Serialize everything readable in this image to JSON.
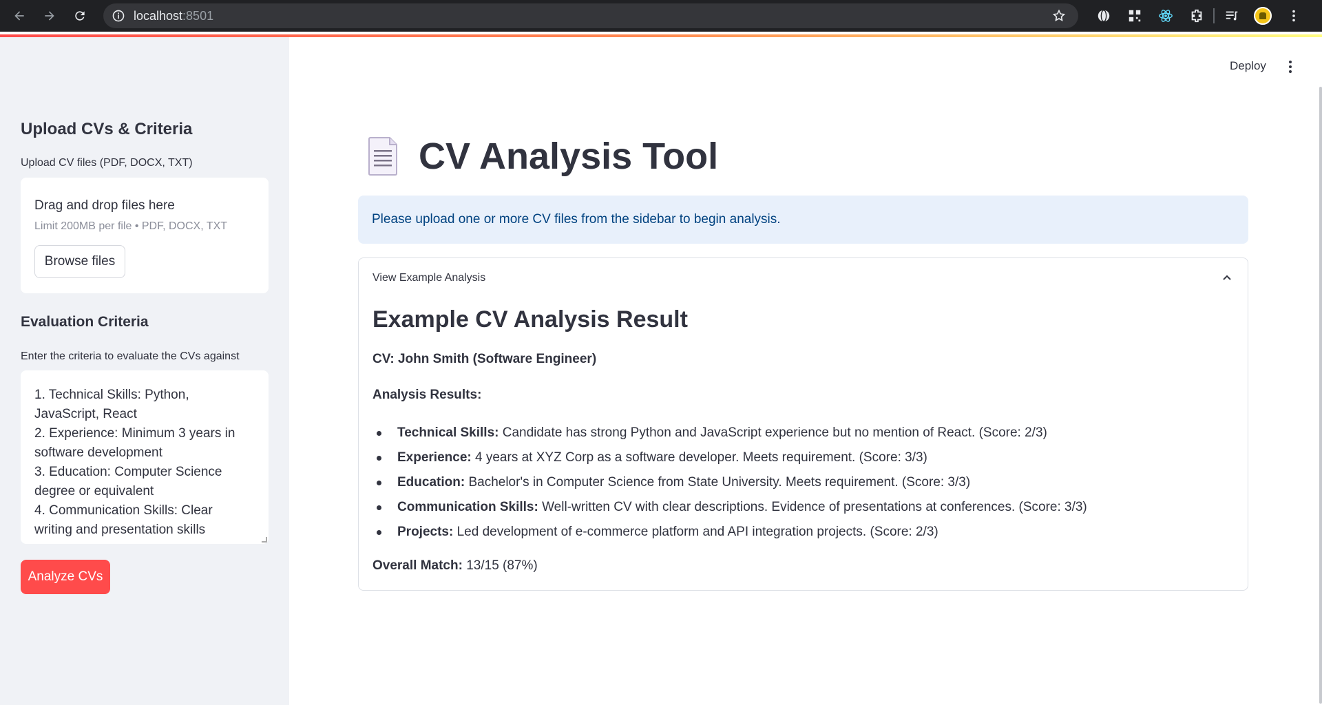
{
  "browser": {
    "url_host": "localhost",
    "url_port": ":8501"
  },
  "header": {
    "deploy_label": "Deploy"
  },
  "sidebar": {
    "upload_heading": "Upload CVs & Criteria",
    "upload_label": "Upload CV files (PDF, DOCX, TXT)",
    "dropzone_title": "Drag and drop files here",
    "dropzone_limit": "Limit 200MB per file • PDF, DOCX, TXT",
    "browse_label": "Browse files",
    "criteria_heading": "Evaluation Criteria",
    "criteria_label": "Enter the criteria to evaluate the CVs against",
    "criteria_lines": [
      "1. Technical Skills: Python,",
      "JavaScript, React",
      "2. Experience: Minimum 3 years in",
      "software development",
      "3. Education: Computer Science",
      "degree or equivalent",
      "4. Communication Skills: Clear",
      "writing and presentation skills"
    ],
    "analyze_label": "Analyze CVs"
  },
  "main": {
    "title": "CV Analysis Tool",
    "info_message": "Please upload one or more CV files from the sidebar to begin analysis.",
    "expander": {
      "label": "View Example Analysis",
      "result_title": "Example CV Analysis Result",
      "cv_line": "CV: John Smith (Software Engineer)",
      "results_label": "Analysis Results:",
      "items": [
        {
          "label": "Technical Skills:",
          "text": " Candidate has strong Python and JavaScript experience but no mention of React. (Score: 2/3)"
        },
        {
          "label": "Experience:",
          "text": " 4 years at XYZ Corp as a software developer. Meets requirement. (Score: 3/3)"
        },
        {
          "label": "Education:",
          "text": " Bachelor's in Computer Science from State University. Meets requirement. (Score: 3/3)"
        },
        {
          "label": "Communication Skills:",
          "text": " Well-written CV with clear descriptions. Evidence of presentations at conferences. (Score: 3/3)"
        },
        {
          "label": "Projects:",
          "text": " Led development of e-commerce platform and API integration projects. (Score: 2/3)"
        }
      ],
      "overall_label": "Overall Match:",
      "overall_value": " 13/15 (87%)"
    }
  }
}
